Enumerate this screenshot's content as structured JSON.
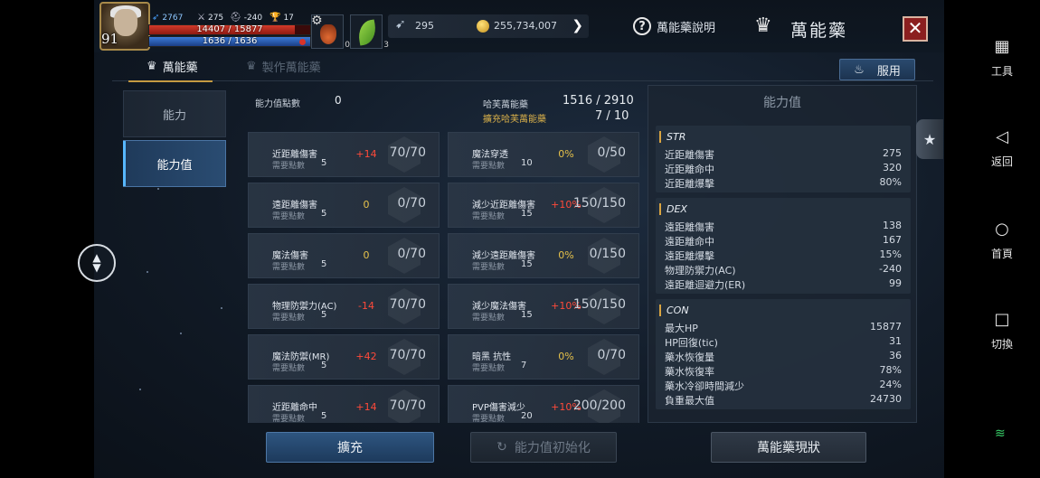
{
  "hud": {
    "level": "91",
    "stat_a": "2767",
    "stat_b": "275",
    "stat_c": "-240",
    "stat_d": "17",
    "hp_text": "14407 / 15877",
    "hp_fraction": 0.907,
    "mp_text": "1636 / 1636",
    "mp_fraction": 1.0,
    "slot1_count": "0",
    "slot2_count": "3",
    "currency1": "295",
    "currency2": "255,734,007",
    "help_label": "萬能藥說明",
    "title": "萬能藥",
    "close_label": "✕"
  },
  "tabs": {
    "tab1_label": "萬能藥",
    "tab2_label": "製作萬能藥",
    "use_label": "服用"
  },
  "nav": {
    "item1": "能力",
    "item2": "能力值"
  },
  "summary": {
    "points_label": "能力值點數",
    "points_value": "0",
    "range_label": "哈芙萬能藥",
    "range_value": "1516 / 2910",
    "expand_label": "擴充哈芙萬能藥",
    "expand_value": "7 / 10"
  },
  "need_label": "需要點數",
  "cards": [
    {
      "name": "近距離傷害",
      "need": "5",
      "bonus": "+14",
      "bonus_color": "red",
      "value": "70/70"
    },
    {
      "name": "魔法穿透",
      "need": "10",
      "bonus": "0%",
      "bonus_color": "yel",
      "value": "0/50"
    },
    {
      "name": "遠距離傷害",
      "need": "5",
      "bonus": "0",
      "bonus_color": "yel",
      "value": "0/70"
    },
    {
      "name": "減少近距離傷害",
      "need": "15",
      "bonus": "+10%",
      "bonus_color": "red",
      "value": "150/150"
    },
    {
      "name": "魔法傷害",
      "need": "5",
      "bonus": "0",
      "bonus_color": "yel",
      "value": "0/70"
    },
    {
      "name": "減少遠距離傷害",
      "need": "15",
      "bonus": "0%",
      "bonus_color": "yel",
      "value": "0/150"
    },
    {
      "name": "物理防禦力(AC)",
      "need": "5",
      "bonus": "-14",
      "bonus_color": "red",
      "value": "70/70"
    },
    {
      "name": "減少魔法傷害",
      "need": "15",
      "bonus": "+10%",
      "bonus_color": "red",
      "value": "150/150"
    },
    {
      "name": "魔法防禦(MR)",
      "need": "5",
      "bonus": "+42",
      "bonus_color": "red",
      "value": "70/70"
    },
    {
      "name": "暗黑 抗性",
      "need": "7",
      "bonus": "0%",
      "bonus_color": "yel",
      "value": "0/70"
    },
    {
      "name": "近距離命中",
      "need": "5",
      "bonus": "+14",
      "bonus_color": "red",
      "value": "70/70"
    },
    {
      "name": "PVP傷害減少",
      "need": "20",
      "bonus": "+10%",
      "bonus_color": "red",
      "value": "200/200"
    }
  ],
  "stats_panel": {
    "title": "能力值",
    "sections": [
      {
        "header": "STR",
        "rows": [
          {
            "label": "近距離傷害",
            "value": "275"
          },
          {
            "label": "近距離命中",
            "value": "320"
          },
          {
            "label": "近距離爆擊",
            "value": "80%"
          }
        ]
      },
      {
        "header": "DEX",
        "rows": [
          {
            "label": "遠距離傷害",
            "value": "138"
          },
          {
            "label": "遠距離命中",
            "value": "167"
          },
          {
            "label": "遠距離爆擊",
            "value": "15%"
          },
          {
            "label": "物理防禦力(AC)",
            "value": "-240"
          },
          {
            "label": "遠距離迴避力(ER)",
            "value": "99"
          }
        ]
      },
      {
        "header": "CON",
        "rows": [
          {
            "label": "最大HP",
            "value": "15877"
          },
          {
            "label": "HP回復(tic)",
            "value": "31"
          },
          {
            "label": "藥水恢復量",
            "value": "36"
          },
          {
            "label": "藥水恢復率",
            "value": "78%"
          },
          {
            "label": "藥水冷卻時間減少",
            "value": "24%"
          },
          {
            "label": "負重最大值",
            "value": "24730"
          }
        ]
      }
    ]
  },
  "buttons": {
    "expand": "擴充",
    "reset": "能力值初始化",
    "status": "萬能藥現狀"
  },
  "sysnav": {
    "tools": "工具",
    "back": "返回",
    "home": "首頁",
    "switch": "切換"
  },
  "colors": {
    "accent_gold": "#c59a42",
    "bonus_red": "#ff4a3a",
    "bonus_yellow": "#e7c24a",
    "primary_button": "#2e5580"
  },
  "icons": {
    "tab": "crown-icon",
    "help": "question-icon",
    "close": "close-icon",
    "scroll": "scroll-updown-icon",
    "side": "star-icon"
  }
}
